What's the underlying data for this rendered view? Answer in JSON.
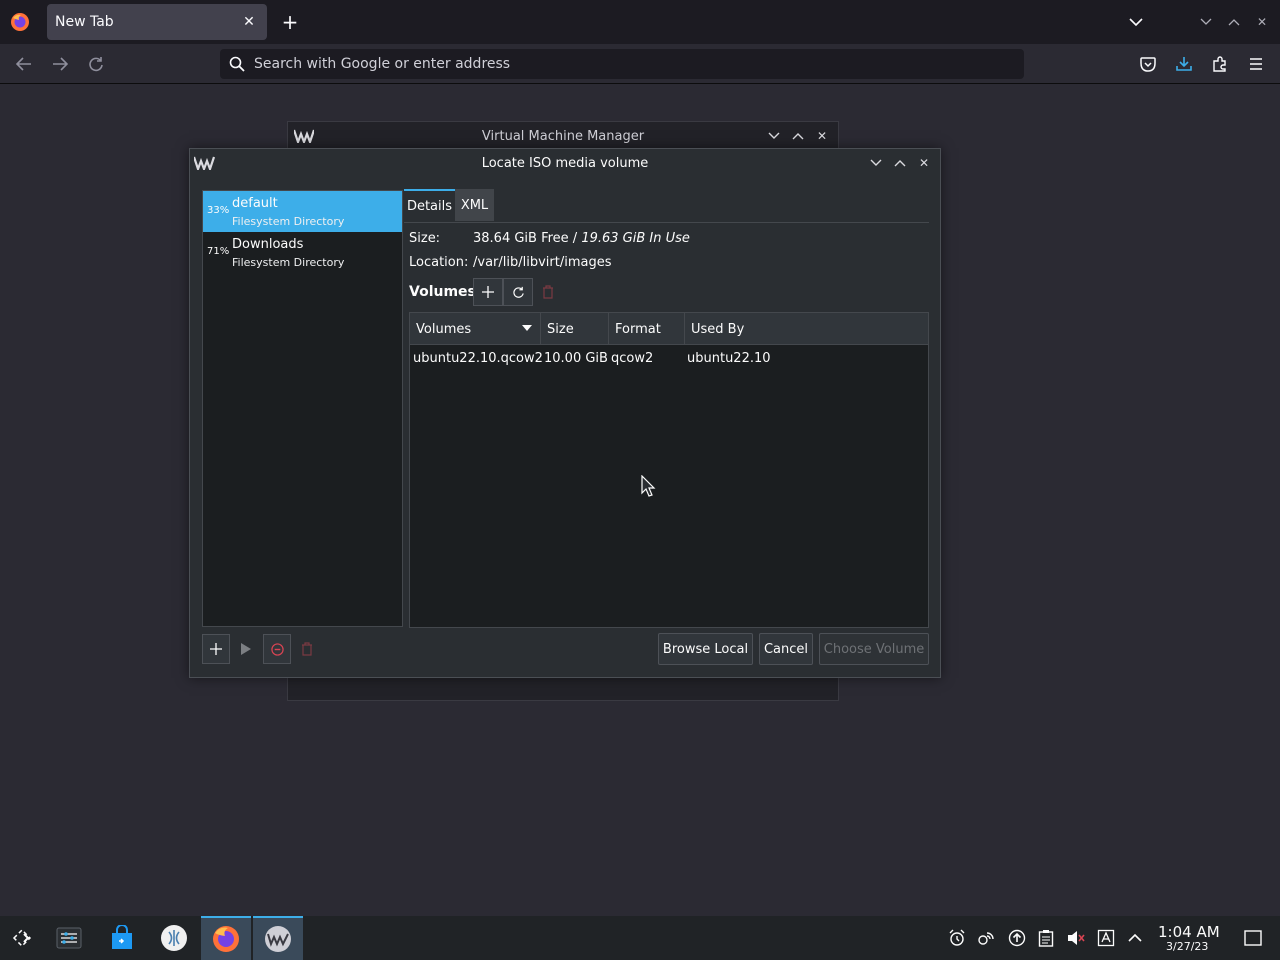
{
  "browser": {
    "tab_title": "New Tab",
    "url_placeholder": "Search with Google or enter address"
  },
  "bg_window": {
    "title": "Virtual Machine Manager"
  },
  "dialog": {
    "title": "Locate ISO media volume",
    "pools": [
      {
        "percent": "33%",
        "name": "default",
        "type": "Filesystem Directory",
        "selected": true
      },
      {
        "percent": "71%",
        "name": "Downloads",
        "type": "Filesystem Directory",
        "selected": false
      }
    ],
    "tabs": [
      "Details",
      "XML"
    ],
    "size_label": "Size:",
    "size_free": "38.64 GiB Free / ",
    "size_used": "19.63 GiB In Use",
    "location_label": "Location:",
    "location_value": "/var/lib/libvirt/images",
    "volumes_label": "Volumes",
    "table": {
      "headers": [
        "Volumes",
        "Size",
        "Format",
        "Used By"
      ],
      "rows": [
        {
          "name": "ubuntu22.10.qcow2",
          "size": "10.00 GiB",
          "format": "qcow2",
          "used_by": "ubuntu22.10"
        }
      ]
    },
    "buttons": {
      "browse_local": "Browse Local",
      "cancel": "Cancel",
      "choose_volume": "Choose Volume"
    }
  },
  "taskbar": {
    "time": "1:04 AM",
    "date": "3/27/23"
  },
  "colors": {
    "accent": "#3daee9",
    "danger": "#da4453"
  }
}
